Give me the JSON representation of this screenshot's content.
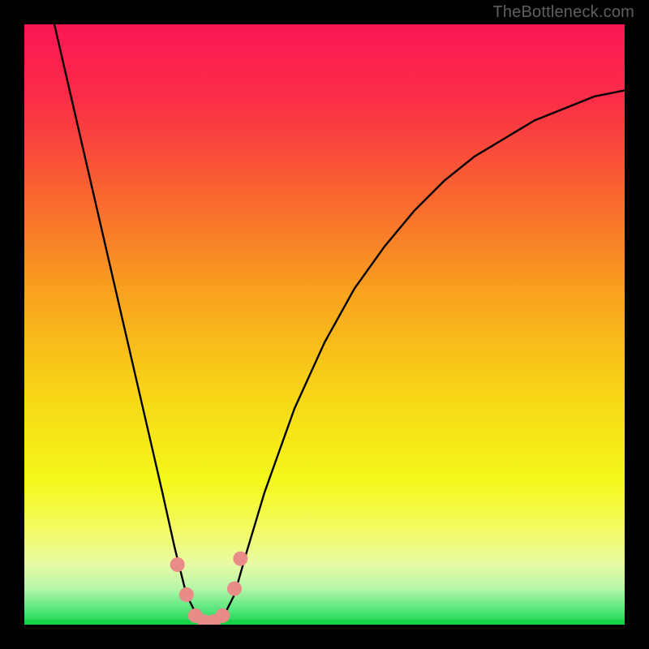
{
  "brand": "TheBottleneck.com",
  "colors": {
    "black": "#000000",
    "curve": "#000000",
    "marker": "#e98b87",
    "green": "#17d34a",
    "text": "#5f5f5f"
  },
  "chart_data": {
    "type": "line",
    "title": "",
    "xlabel": "",
    "ylabel": "",
    "xlim": [
      0,
      100
    ],
    "ylim": [
      0,
      100
    ],
    "grid": false,
    "legend": false,
    "annotations": [],
    "background": {
      "type": "vertical-gradient",
      "description": "Smooth gradient over the plot area transitioning red at the top through orange, yellow, pale yellow, pale green, to thin bright green strip at the very bottom",
      "stops": [
        {
          "offset": 0.0,
          "color": "#fb1754"
        },
        {
          "offset": 0.12,
          "color": "#fb2c48"
        },
        {
          "offset": 0.28,
          "color": "#f96430"
        },
        {
          "offset": 0.45,
          "color": "#f9a31e"
        },
        {
          "offset": 0.62,
          "color": "#f7d716"
        },
        {
          "offset": 0.76,
          "color": "#f4f81a"
        },
        {
          "offset": 0.84,
          "color": "#f4fb62"
        },
        {
          "offset": 0.9,
          "color": "#e8fba6"
        },
        {
          "offset": 0.94,
          "color": "#b6f6a8"
        },
        {
          "offset": 0.975,
          "color": "#55e67c"
        },
        {
          "offset": 1.0,
          "color": "#17d34a"
        }
      ]
    },
    "series": [
      {
        "name": "bottleneck-curve",
        "description": "V-shaped black curve; both arms rise from a flat minimum region near x≈27..33 at y≈0",
        "x": [
          5,
          8,
          11,
          14,
          17,
          20,
          23,
          25,
          27,
          29,
          30,
          31,
          33,
          35,
          37,
          40,
          45,
          50,
          55,
          60,
          65,
          70,
          75,
          80,
          85,
          90,
          95,
          100
        ],
        "y": [
          100,
          87,
          74,
          61,
          48,
          35,
          22,
          13,
          5,
          1,
          0,
          0,
          1,
          5,
          12,
          22,
          36,
          47,
          56,
          63,
          69,
          74,
          78,
          81,
          84,
          86,
          88,
          89
        ]
      }
    ],
    "markers": {
      "name": "highlight-dots",
      "description": "Short sequence of salmon-colored rounded dots tracing the very bottom of the V",
      "points": [
        {
          "x": 25.5,
          "y": 10
        },
        {
          "x": 27.0,
          "y": 5
        },
        {
          "x": 28.5,
          "y": 1.5
        },
        {
          "x": 30.0,
          "y": 0.5
        },
        {
          "x": 31.5,
          "y": 0.5
        },
        {
          "x": 33.0,
          "y": 1.5
        },
        {
          "x": 35.0,
          "y": 6
        },
        {
          "x": 36.0,
          "y": 11
        }
      ],
      "radius_px": 9
    }
  }
}
